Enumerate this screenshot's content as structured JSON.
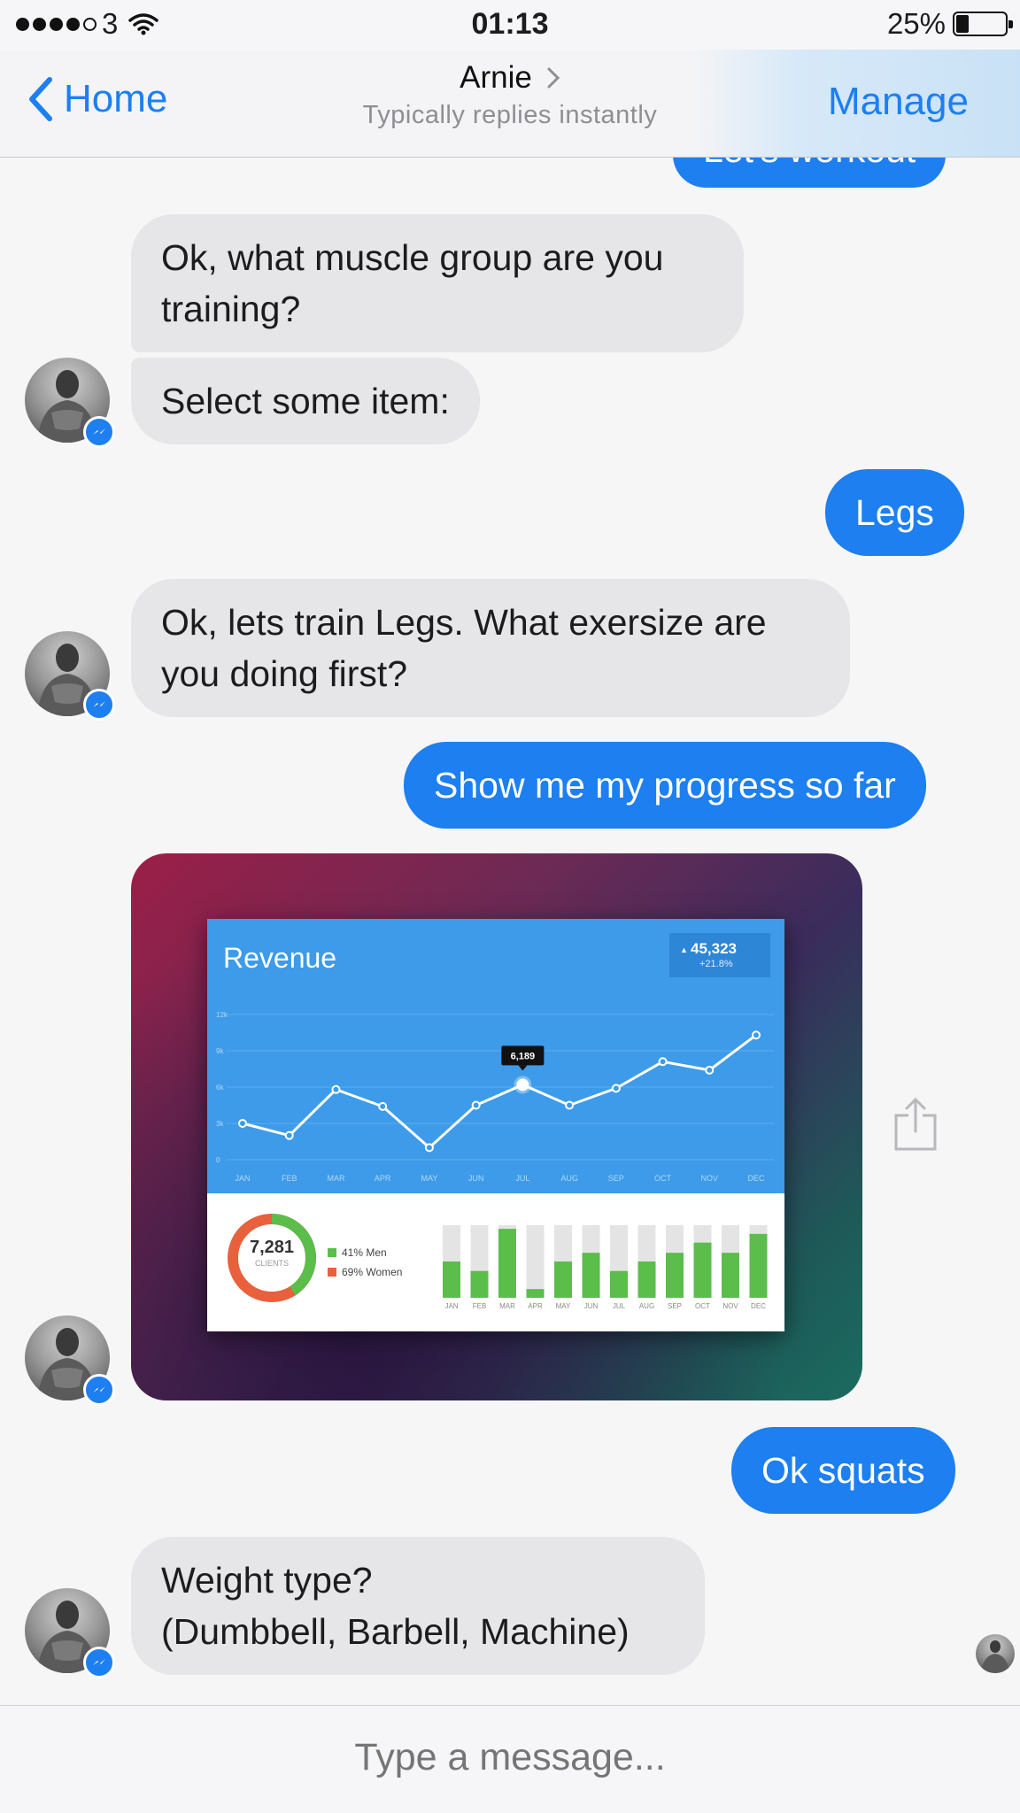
{
  "status_bar": {
    "carrier": "3",
    "time": "01:13",
    "battery_percent_label": "25%",
    "battery_level": 0.25,
    "signal_bars_filled": 4,
    "signal_bars_total": 5
  },
  "nav": {
    "back_label": "Home",
    "title": "Arnie",
    "subtitle": "Typically replies instantly",
    "manage_label": "Manage"
  },
  "messages": {
    "partial_out": "Let's workout",
    "m1": "Ok, what muscle group are you\ntraining?",
    "m2": "Select some item:",
    "m3": "Legs",
    "m4": "Ok, lets train Legs. What exersize are\nyou doing first?",
    "m5": "Show me my progress so far",
    "m6": "Ok squats",
    "m7": "Weight type?\n(Dumbbell, Barbell, Machine)"
  },
  "dashboard": {
    "title": "Revenue",
    "total": "45,323",
    "change": "+21.8%",
    "tooltip": "6,189",
    "clients_value": "7,281",
    "clients_label": "CLIENTS",
    "legend_men": "41% Men",
    "legend_women": "69% Women",
    "men_fraction": 0.41
  },
  "chart_data": [
    {
      "type": "line",
      "title": "Revenue",
      "categories": [
        "JAN",
        "FEB",
        "MAR",
        "APR",
        "MAY",
        "JUN",
        "JUL",
        "AUG",
        "SEP",
        "OCT",
        "NOV",
        "DEC"
      ],
      "values": [
        3000,
        2000,
        5800,
        4400,
        1000,
        4500,
        6189,
        4500,
        5900,
        8100,
        7400,
        10300
      ],
      "y_ticks": [
        "0",
        "3k",
        "6k",
        "9k",
        "12k"
      ],
      "ylim": [
        0,
        12000
      ],
      "grid": true
    },
    {
      "type": "bar",
      "categories": [
        "JAN",
        "FEB",
        "MAR",
        "APR",
        "MAY",
        "JUN",
        "JUL",
        "AUG",
        "SEP",
        "OCT",
        "NOV",
        "DEC"
      ],
      "values": [
        0.5,
        0.37,
        0.95,
        0.12,
        0.5,
        0.62,
        0.37,
        0.5,
        0.62,
        0.76,
        0.62,
        0.88
      ],
      "ylim": [
        0,
        1
      ]
    }
  ],
  "composer": {
    "placeholder": "Type a message..."
  },
  "colors": {
    "accent": "#1d7ff0",
    "incoming_bubble": "#e6e6e8",
    "dashboard_blue": "#3d9be9",
    "bar_green": "#5bbd4a",
    "donut_red": "#e8603c"
  }
}
